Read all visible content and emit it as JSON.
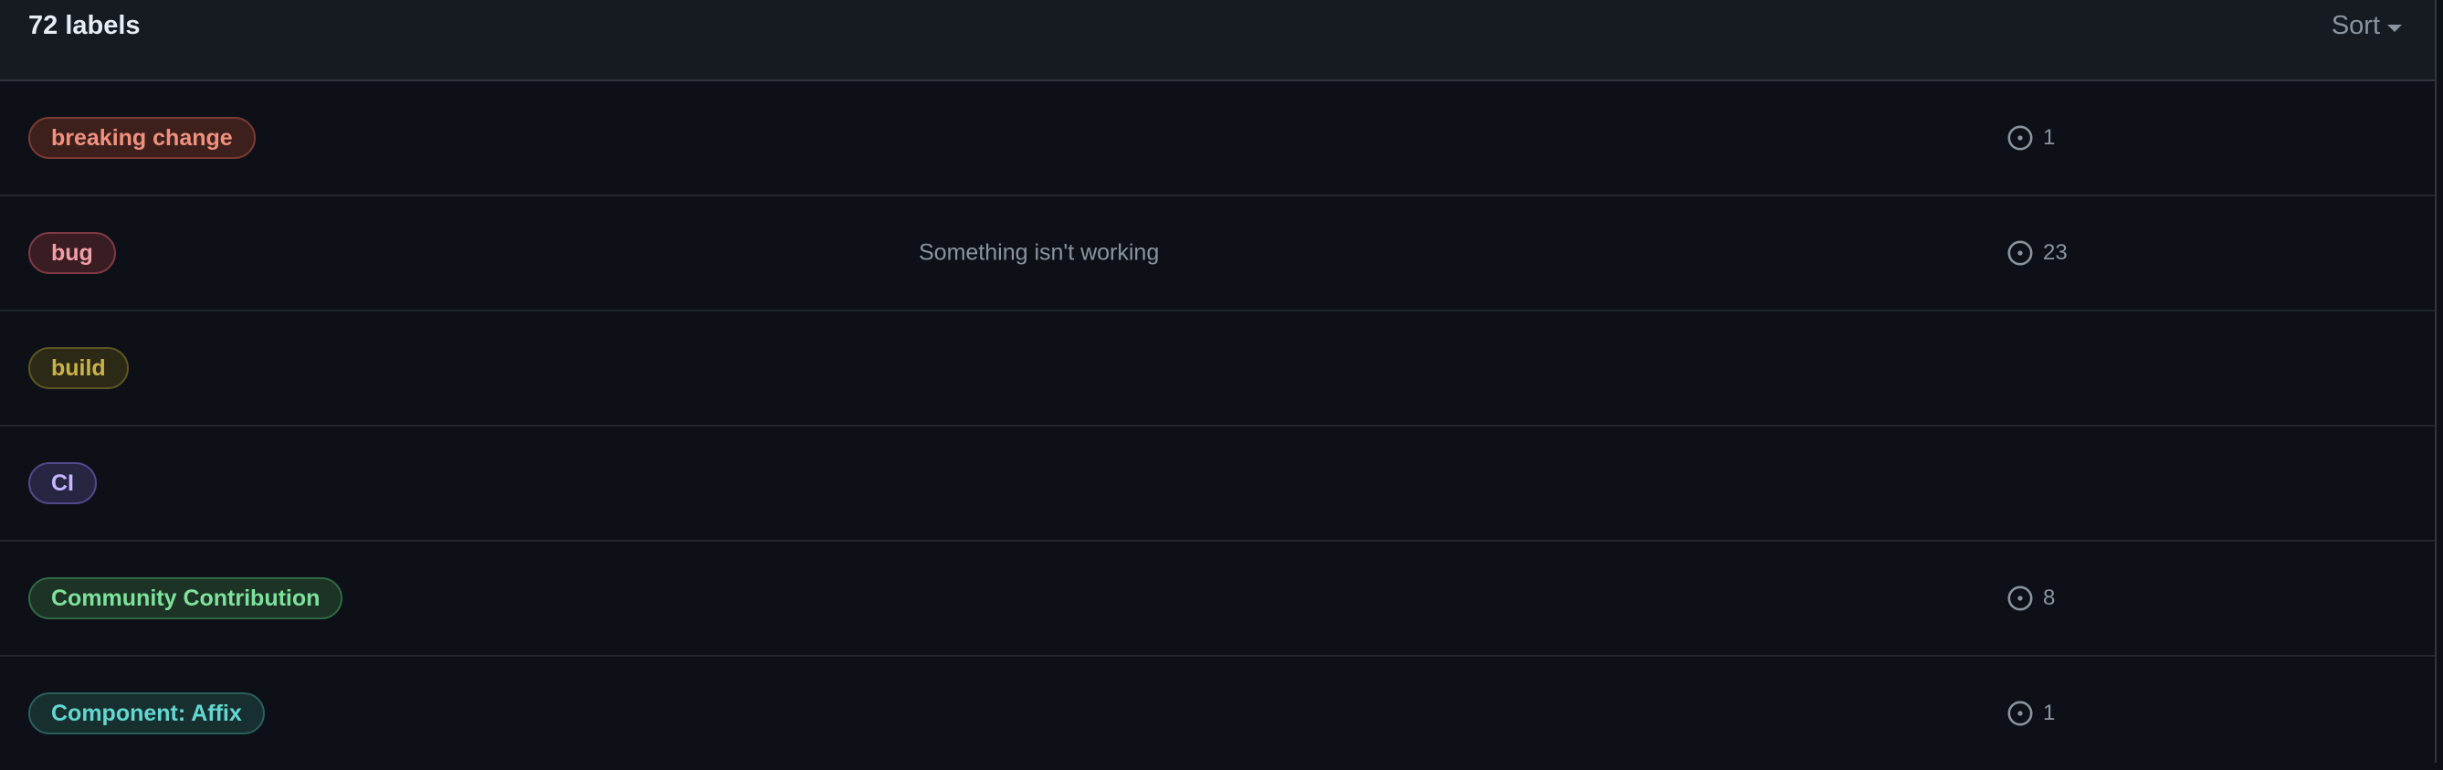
{
  "header": {
    "count_text": "72 labels",
    "sort_label": "Sort"
  },
  "labels": [
    {
      "name": "breaking change",
      "description": "",
      "issues": "1",
      "text_color": "#f0917f",
      "bg_color": "#3d1f1c",
      "border_color": "#7a3a33"
    },
    {
      "name": "bug",
      "description": "Something isn't working",
      "issues": "23",
      "text_color": "#ef9fa6",
      "bg_color": "#3a1d22",
      "border_color": "#7e3a43"
    },
    {
      "name": "build",
      "description": "",
      "issues": "",
      "text_color": "#cab34a",
      "bg_color": "#2c2a16",
      "border_color": "#5d5523"
    },
    {
      "name": "CI",
      "description": "",
      "issues": "",
      "text_color": "#c4b7ff",
      "bg_color": "#272642",
      "border_color": "#50498a"
    },
    {
      "name": "Community Contribution",
      "description": "",
      "issues": "8",
      "text_color": "#7ee29c",
      "bg_color": "#1c3325",
      "border_color": "#2f6a44"
    },
    {
      "name": "Component: Affix",
      "description": "",
      "issues": "1",
      "text_color": "#63d7d1",
      "bg_color": "#17302f",
      "border_color": "#2a5e5b"
    }
  ]
}
